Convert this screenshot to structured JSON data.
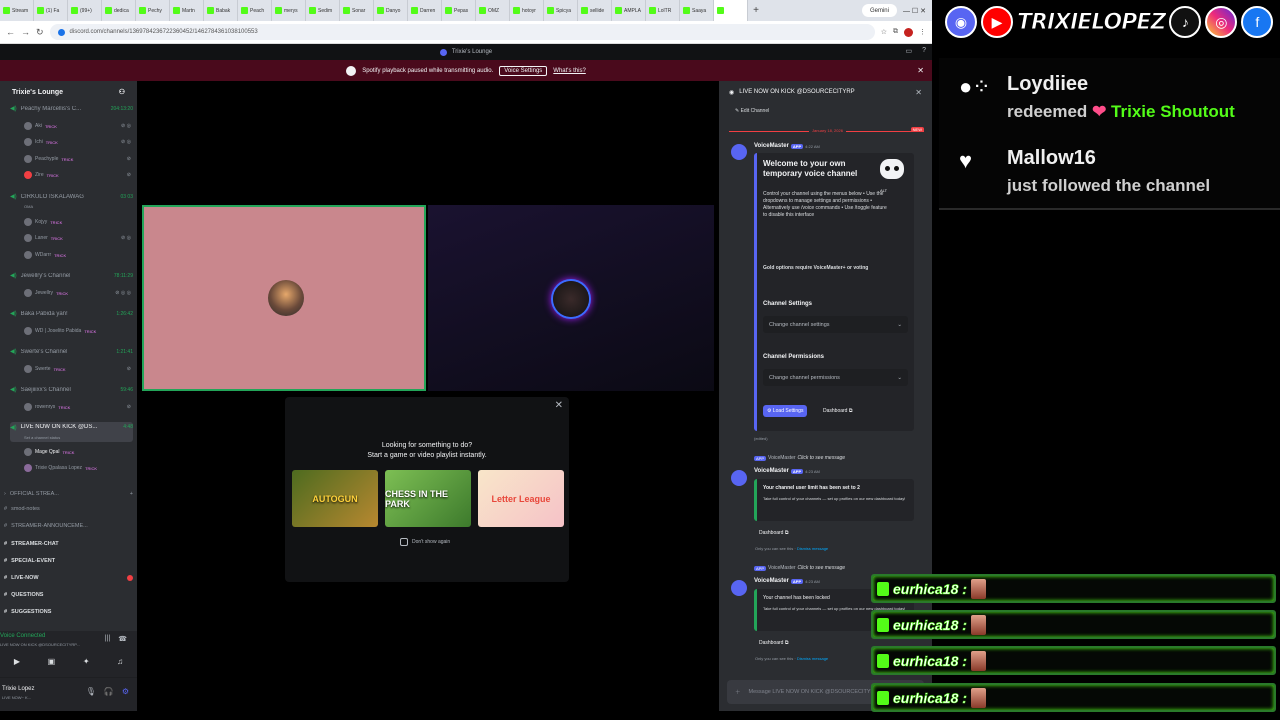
{
  "browser": {
    "tabs": [
      "Stream",
      "(1) Fa",
      "(99+)",
      "dedica",
      "Pechy",
      "Martn",
      "Babak",
      "Peach",
      "merys",
      "Sedim",
      "Sonar",
      "Danyo",
      "Darren",
      "Pepas",
      "OMZ",
      "hotoyr",
      "Spicya",
      "sellide",
      "AMPLA",
      "LolTR",
      "Saaya",
      ""
    ],
    "new_tab": "+",
    "gemini_label": "Gemini",
    "url": "discord.com/channels/1369784236722360452/1462784361038100553"
  },
  "discord": {
    "server_title": "Trixie's Lounge",
    "notice_text": "Spotify playback paused while transmitting audio.",
    "notice_button": "Voice Settings",
    "notice_link": "What's this?",
    "server_name": "Trixie's Lounge",
    "channels": {
      "c1": {
        "name": "Peachy Marcellis's C...",
        "dur": "204:13:20"
      },
      "c1_members": [
        "Aki",
        "Ichi",
        "Peachyple",
        "Zire"
      ],
      "c2": {
        "name": "CIRKULO ISKALAWAG",
        "dur": "03 03"
      },
      "c2_sub": "OMA",
      "c2_members": [
        "Kojyy",
        "Laner",
        "WDarrr"
      ],
      "c3": {
        "name": "Jewellry's Channel",
        "dur": "78:11:29"
      },
      "c3_members": [
        "Jewellry"
      ],
      "c4": {
        "name": "Baka Pabida yan!",
        "dur": "1:26:42"
      },
      "c4_members": [
        "WD | Joselito Pabida"
      ],
      "c5": {
        "name": "Swerte's Channel",
        "dur": "1:21:41"
      },
      "c5_members": [
        "Swerte"
      ],
      "c6": {
        "name": "Saejiiixx's Channel",
        "dur": "59:46"
      },
      "c6_members": [
        "rowenrys"
      ],
      "c7": {
        "name": "LIVE NOW ON KICK @DS...",
        "dur": "4:48"
      },
      "c7_sub": "Set a channel status",
      "c7_members": [
        "Mage Qpal",
        "Trixie Qpalasa Lopez"
      ],
      "tag": "TRICK"
    },
    "categories": [
      "OFFICIAL STREA...",
      "smod-notes",
      "STREAMER-ANNOUNCEME...",
      "STREAMER-CHAT",
      "SPECIAL-EVENT",
      "LIVE-NOW",
      "QUESTIONS",
      "SUGGESTIONS"
    ],
    "voice_connected": "Voice Connected",
    "voice_channel": "LIVE NOW ON KICK @DSOURCECITYRP...",
    "user_name": "Trixie Lopez",
    "user_status": "LIVE NOW~ K...",
    "activity": {
      "line1": "Looking for something to do?",
      "line2": "Start a game or video playlist instantly.",
      "games": [
        "AUTOGUN",
        "CHESS IN THE PARK",
        "Letter League"
      ],
      "dont_show": "Don't show again"
    },
    "chat": {
      "header": "LIVE NOW ON KICK @DSOURCECITYRP",
      "edit_channel": "Edit Channel",
      "date": "January 18, 2026",
      "new": "NEW",
      "bot": "VoiceMaster",
      "app": "APP",
      "time1": "4:22 AM",
      "welcome_title": "Welcome to your own temporary voice channel",
      "welcome_desc": "Control your channel using the menus below • Use the dropdowns to manage settings and permissions • Alternatively use /voice commands • Use /toggle feature to disable this interface",
      "gold": "Gold options require VoiceMaster+ or voting",
      "alt": "ALT",
      "channel_settings": "Channel Settings",
      "channel_settings_ph": "Change channel settings",
      "channel_perms": "Channel Permissions",
      "channel_perms_ph": "Change channel permissions",
      "load_settings": "Load Settings",
      "dashboard": "Dashboard",
      "edited": "(edited)",
      "click_to_see": "Click to see message",
      "time2": "4:23 AM",
      "limit_msg": "Your channel user limit has been set to 2",
      "promo": "Take full control of your channels — set up profiles on our new dashboard today!",
      "only_you": "Only you can see this ·",
      "dismiss": "Dismiss message",
      "locked_msg": "Your channel has been locked",
      "input_ph": "Message LIVE NOW ON KICK @DSOURCECITYRP"
    }
  },
  "overlay": {
    "brand": "TRIXIELOPEZ",
    "alert1_name": "Loydiiee",
    "alert1_action": "redeemed",
    "alert1_reward": "Trixie Shoutout",
    "alert2_name": "Mallow16",
    "alert2_action": "just followed the channel",
    "chat_user": "eurhica18 :"
  }
}
